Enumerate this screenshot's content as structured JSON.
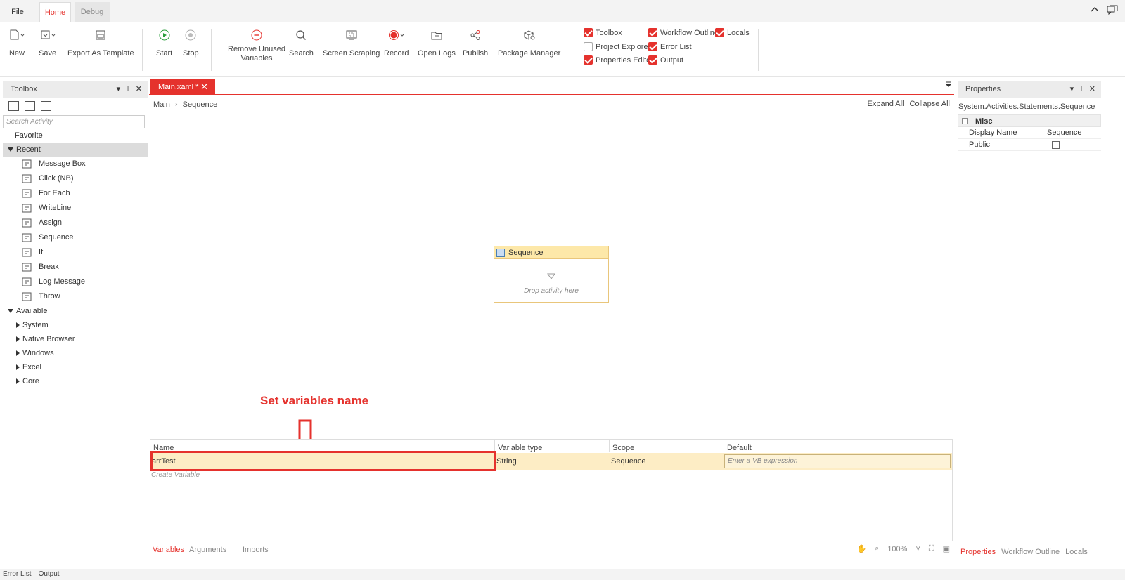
{
  "menu": {
    "file": "File",
    "home": "Home",
    "debug": "Debug"
  },
  "ribbon": {
    "new": "New",
    "save": "Save",
    "export_template": "Export As Template",
    "start": "Start",
    "stop": "Stop",
    "remove_unused_1": "Remove Unused",
    "remove_unused_2": "Variables",
    "search": "Search",
    "screen_scraping": "Screen Scraping",
    "record": "Record",
    "open_logs": "Open Logs",
    "publish": "Publish",
    "package_manager": "Package Manager",
    "checks": {
      "toolbox": "Toolbox",
      "project_explorer": "Project Explorer",
      "properties_editor": "Properties Editor",
      "workflow_outline": "Workflow Outline",
      "error_list": "Error List",
      "output": "Output",
      "locals": "Locals"
    },
    "accent": "#e5322d"
  },
  "toolbox": {
    "title": "Toolbox",
    "search_placeholder": "Search Activity",
    "favorite": "Favorite",
    "recent": "Recent",
    "recent_items": [
      "Message Box",
      "Click (NB)",
      "For Each",
      "WriteLine",
      "Assign",
      "Sequence",
      "If",
      "Break",
      "Log Message",
      "Throw"
    ],
    "available": "Available",
    "available_groups": [
      "System",
      "Native Browser",
      "Windows",
      "Excel",
      "Core"
    ]
  },
  "designer": {
    "tab_label": "Main.xaml *",
    "breadcrumb": [
      "Main",
      "Sequence"
    ],
    "expand_all": "Expand All",
    "collapse_all": "Collapse All",
    "sequence_title": "Sequence",
    "drop_text": "Drop activity here",
    "annotation": "Set variables name"
  },
  "variables": {
    "headers": [
      "Name",
      "Variable type",
      "Scope",
      "Default"
    ],
    "row": {
      "name": "arrTest",
      "type": "String",
      "scope": "Sequence",
      "default_placeholder": "Enter a VB expression"
    },
    "create": "Create Variable",
    "footer_tabs": [
      "Variables",
      "Arguments",
      "Imports"
    ],
    "zoom": "100%"
  },
  "properties": {
    "title": "Properties",
    "type": "System.Activities.Statements.Sequence",
    "category": "Misc",
    "display_name_label": "Display Name",
    "display_name_value": "Sequence",
    "public_label": "Public",
    "footer_tabs": [
      "Properties",
      "Workflow Outline",
      "Locals"
    ]
  },
  "bottom": {
    "error_list": "Error List",
    "output": "Output"
  }
}
